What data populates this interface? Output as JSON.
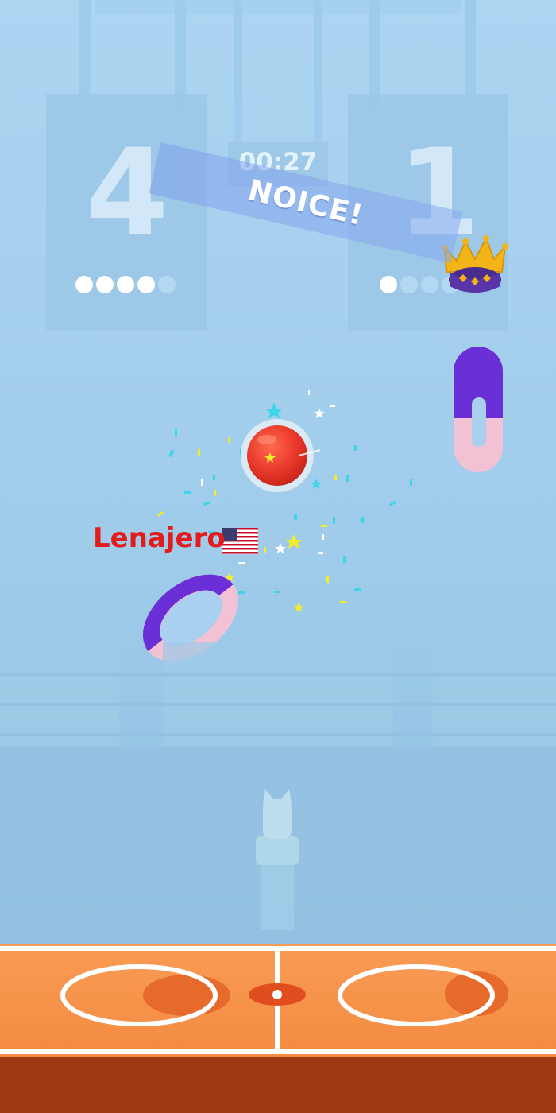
{
  "hud": {
    "left_score": "4",
    "right_score": "1",
    "timer": "00:27",
    "left_shots_filled": 4,
    "left_shots_total": 5,
    "right_shots_filled": 1,
    "right_shots_total": 5,
    "leader_indicator_icon": "crown-icon"
  },
  "banner": {
    "text": "NOICE!"
  },
  "player": {
    "name": "Lenajero",
    "flag_icon": "us-flag-icon"
  },
  "colors": {
    "sky": "#a9d1ef",
    "court_orange": "#f7934b",
    "court_line": "#ffffff",
    "court_edge": "#9d3a15",
    "ball_red": "#e8382a",
    "ring_purple": "#6a2fd6",
    "ring_pink": "#f2c1d4",
    "name_red": "#e21c1c",
    "crown_gold": "#f2b416"
  }
}
